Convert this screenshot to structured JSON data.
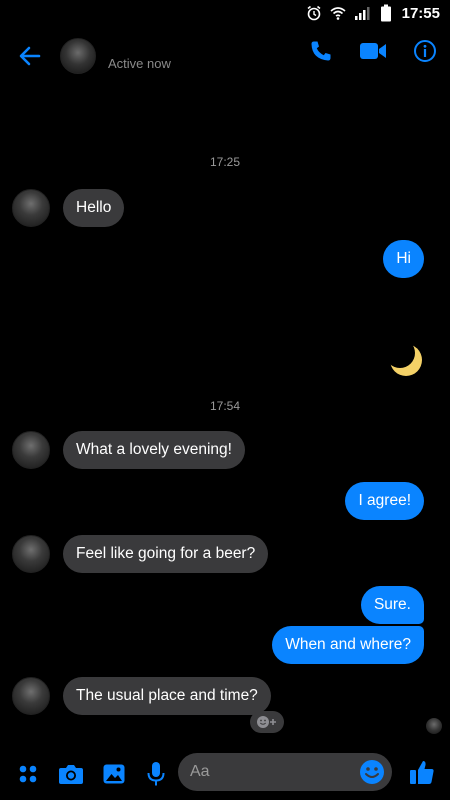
{
  "status_bar": {
    "time": "17:55",
    "icons": [
      "alarm-icon",
      "wifi-icon",
      "signal-icon",
      "battery-icon"
    ]
  },
  "header": {
    "back_icon": "back-arrow-icon",
    "status": "Active now",
    "actions": [
      "phone-icon",
      "video-icon",
      "info-icon"
    ],
    "accent_color": "#0a84ff"
  },
  "timestamps": [
    "17:25",
    "17:54"
  ],
  "messages": [
    {
      "direction": "in",
      "text": "Hello"
    },
    {
      "direction": "out",
      "text": "Hi"
    },
    {
      "direction": "out",
      "emoji": "crescent-moon-icon"
    },
    {
      "direction": "in",
      "text": "What a lovely evening!"
    },
    {
      "direction": "out",
      "text": "I agree!"
    },
    {
      "direction": "in",
      "text": "Feel like going for a beer?"
    },
    {
      "direction": "out",
      "text": "Sure."
    },
    {
      "direction": "out",
      "text": "When and where?"
    },
    {
      "direction": "in",
      "text": "The usual place and time?"
    }
  ],
  "composer": {
    "placeholder": "Aa",
    "icons": [
      "more-icon",
      "camera-icon",
      "gallery-icon",
      "mic-icon",
      "emoji-icon",
      "like-icon"
    ]
  },
  "colors": {
    "background": "#000000",
    "incoming_bubble": "#3a3a3c",
    "outgoing_bubble": "#0a84ff"
  }
}
